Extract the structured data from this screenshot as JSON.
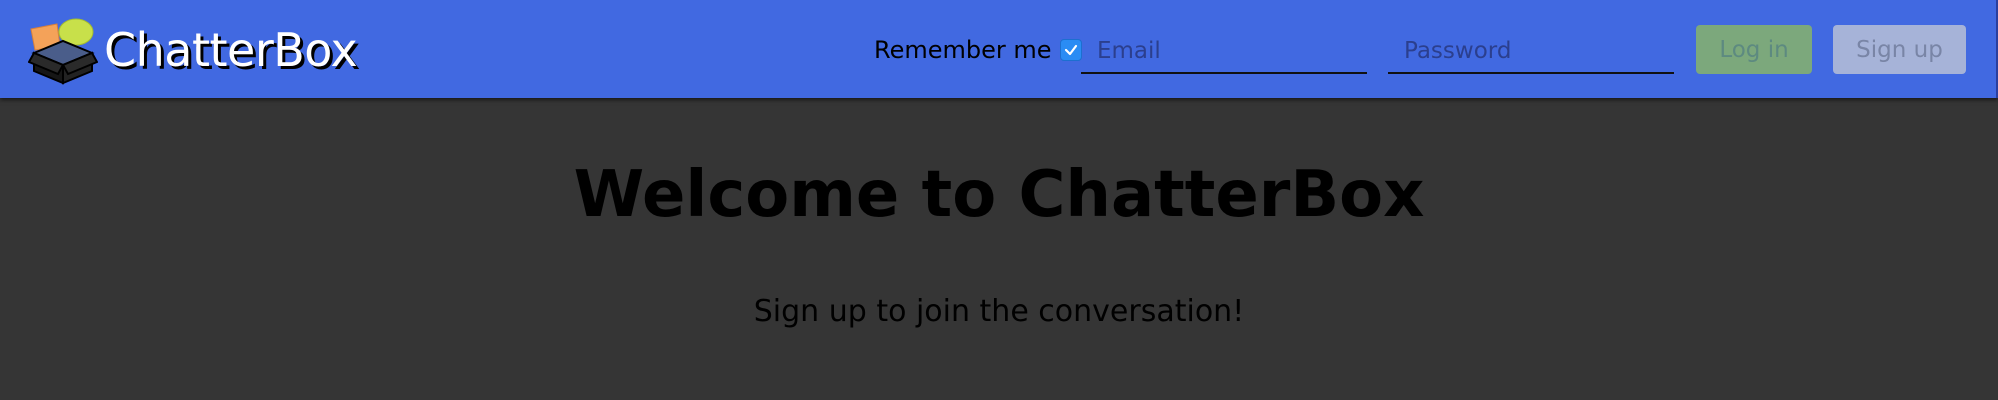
{
  "header": {
    "brand": "ChatterBox",
    "logo_icon": "chat-box-logo-icon",
    "remember_label": "Remember me",
    "remember_checked": true,
    "email_placeholder": "Email",
    "password_placeholder": "Password",
    "login_label": "Log in",
    "signup_label": "Sign up"
  },
  "main": {
    "title": "Welcome to ChatterBox",
    "subtitle": "Sign up to join the conversation!"
  },
  "colors": {
    "navbar": "#4169e1",
    "background": "#353535",
    "login_button": "#7ca87c",
    "signup_button": "#a6b3d8",
    "checkbox": "#2a8cf4"
  }
}
